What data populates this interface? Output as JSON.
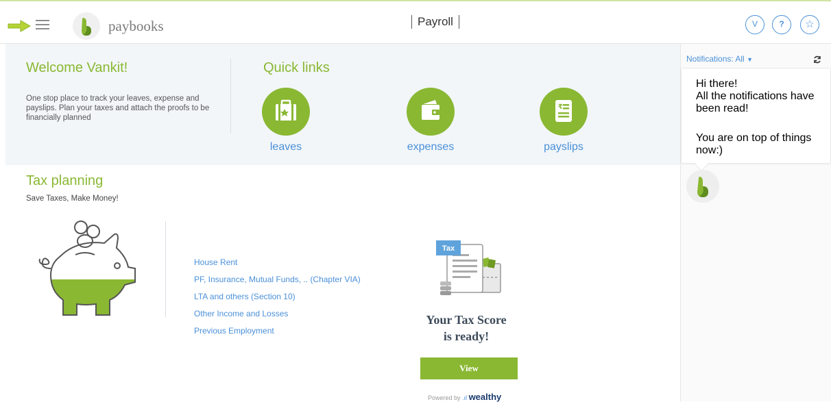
{
  "header": {
    "brand": "paybooks",
    "app_title": "Payroll",
    "user_initial": "V",
    "help_label": "?",
    "favorite_label": "☆"
  },
  "welcome": {
    "title": "Welcome Vankit!",
    "description": "One stop place to track your leaves, expense and payslips. Plan your taxes and attach the proofs to be financially planned"
  },
  "quick_links": {
    "title": "Quick links",
    "items": [
      {
        "label": "leaves",
        "icon": "suitcase-icon"
      },
      {
        "label": "expenses",
        "icon": "wallet-icon"
      },
      {
        "label": "payslips",
        "icon": "payslip-document-icon"
      }
    ]
  },
  "tax_planning": {
    "title": "Tax planning",
    "subtitle": "Save Taxes, Make Money!",
    "links": [
      "House Rent",
      "PF, Insurance, Mutual Funds, .. (Chapter VIA)",
      "LTA and others (Section 10)",
      "Other Income and Losses",
      "Previous Employment"
    ],
    "doc_label": "Tax",
    "score_line1": "Your Tax Score",
    "score_line2": "is ready!",
    "view_button": "View",
    "powered_by": "Powered by",
    "partner": "wealthy"
  },
  "notifications": {
    "label": "Notifications:",
    "filter": "All",
    "line1": "Hi there!",
    "line2": "All the notifications have been read!",
    "line3": "You are on top of things now:)"
  },
  "colors": {
    "accent_green": "#8ab833",
    "link_blue": "#4a90d9"
  }
}
